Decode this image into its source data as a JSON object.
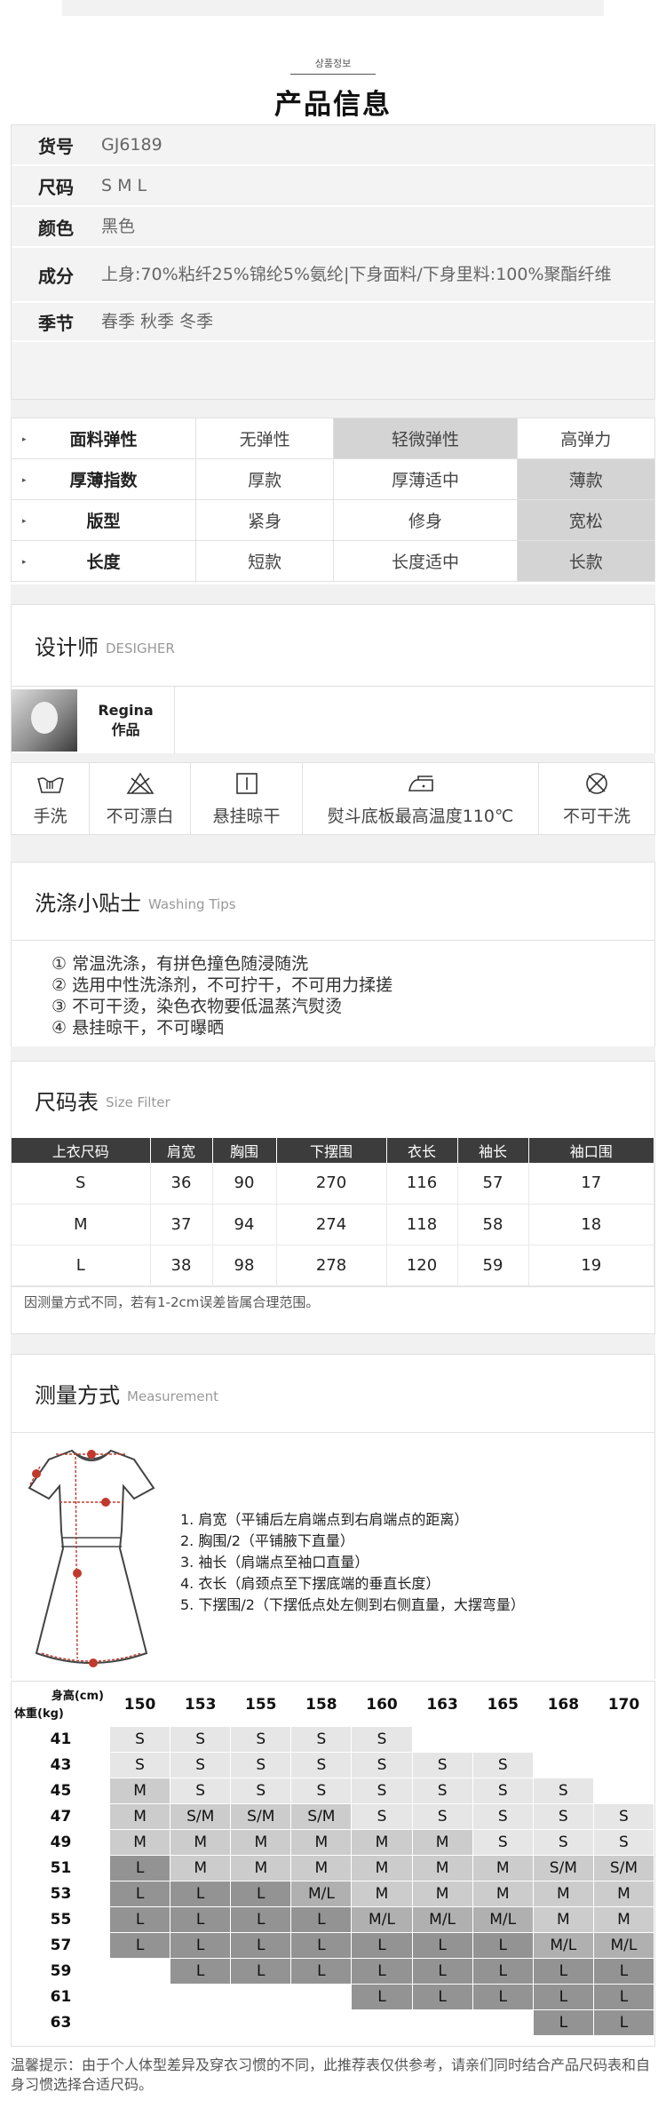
{
  "header": {
    "small_title": "상품정보",
    "big_title": "产品信息"
  },
  "info": [
    {
      "key": "货号",
      "value": "GJ6189"
    },
    {
      "key": "尺码",
      "value": "S M L"
    },
    {
      "key": "颜色",
      "value": "黑色"
    },
    {
      "key": "成分",
      "value": "上身:70%粘纤25%锦纶5%氨纶|下身面料/下身里料:100%聚酯纤维"
    },
    {
      "key": "季节",
      "value": "春季 秋季 冬季"
    }
  ],
  "attributes": [
    {
      "label": "面料弹性",
      "options": [
        "无弹性",
        "轻微弹性",
        "高弹力"
      ],
      "selected": 1
    },
    {
      "label": "厚薄指数",
      "options": [
        "厚款",
        "厚薄适中",
        "薄款"
      ],
      "selected": 2
    },
    {
      "label": "版型",
      "options": [
        "紧身",
        "修身",
        "宽松"
      ],
      "selected": 2
    },
    {
      "label": "长度",
      "options": [
        "短款",
        "长度适中",
        "长款"
      ],
      "selected": 2
    }
  ],
  "designer": {
    "title": "设计师",
    "title_en": "DESIGHER",
    "name": "Regina",
    "works": "作品"
  },
  "care": [
    {
      "icon": "hand-wash-icon",
      "label": "手洗"
    },
    {
      "icon": "no-bleach-icon",
      "label": "不可漂白"
    },
    {
      "icon": "hang-dry-icon",
      "label": "悬挂晾干"
    },
    {
      "icon": "iron-icon",
      "label": "熨斗底板最高温度110℃"
    },
    {
      "icon": "no-dry-clean-icon",
      "label": "不可干洗"
    }
  ],
  "washing_tips": {
    "title": "洗涤小贴士",
    "title_en": "Washing Tips",
    "items": [
      "① 常温洗涤，有拼色撞色随浸随洗",
      "② 选用中性洗涤剂，不可拧干，不可用力揉搓",
      "③ 不可干烫，染色衣物要低温蒸汽熨烫",
      "④ 悬挂晾干，不可曝晒"
    ]
  },
  "size_chart": {
    "title": "尺码表",
    "title_en": "Size Filter",
    "headers": [
      "上衣尺码",
      "肩宽",
      "胸围",
      "下摆围",
      "衣长",
      "袖长",
      "袖口围"
    ],
    "rows": [
      [
        "S",
        "36",
        "90",
        "270",
        "116",
        "57",
        "17"
      ],
      [
        "M",
        "37",
        "94",
        "274",
        "118",
        "58",
        "18"
      ],
      [
        "L",
        "38",
        "98",
        "278",
        "120",
        "59",
        "19"
      ]
    ],
    "note": "因测量方式不同，若有1-2cm误差皆属合理范围。"
  },
  "measurement": {
    "title": "测量方式",
    "title_en": "Measurement",
    "items": [
      "1. 肩宽（平铺后左肩端点到右肩端点的距离）",
      "2. 胸围/2（平铺腋下直量）",
      "3. 袖长（肩端点至袖口直量）",
      "4. 衣长（肩颈点至下摆底端的垂直长度）",
      "5. 下摆围/2（下摆低点处左侧到右侧直量，大摆弯量）"
    ]
  },
  "recommend": {
    "height_label": "身高(cm)",
    "weight_label": "体重(kg)",
    "heights": [
      "150",
      "153",
      "155",
      "158",
      "160",
      "163",
      "165",
      "168",
      "170"
    ],
    "rows": [
      {
        "w": "41",
        "c": [
          "S",
          "S",
          "S",
          "S",
          "S",
          "",
          "",
          "",
          ""
        ]
      },
      {
        "w": "43",
        "c": [
          "S",
          "S",
          "S",
          "S",
          "S",
          "S",
          "S",
          "",
          ""
        ]
      },
      {
        "w": "45",
        "c": [
          "M",
          "S",
          "S",
          "S",
          "S",
          "S",
          "S",
          "S",
          ""
        ]
      },
      {
        "w": "47",
        "c": [
          "M",
          "S/M",
          "S/M",
          "S/M",
          "S",
          "S",
          "S",
          "S",
          "S"
        ]
      },
      {
        "w": "49",
        "c": [
          "M",
          "M",
          "M",
          "M",
          "M",
          "M",
          "S",
          "S",
          "S"
        ]
      },
      {
        "w": "51",
        "c": [
          "L",
          "M",
          "M",
          "M",
          "M",
          "M",
          "M",
          "S/M",
          "S/M"
        ]
      },
      {
        "w": "53",
        "c": [
          "L",
          "L",
          "L",
          "M/L",
          "M",
          "M",
          "M",
          "M",
          "M"
        ]
      },
      {
        "w": "55",
        "c": [
          "L",
          "L",
          "L",
          "L",
          "M/L",
          "M/L",
          "M/L",
          "M",
          "M"
        ]
      },
      {
        "w": "57",
        "c": [
          "L",
          "L",
          "L",
          "L",
          "L",
          "L",
          "L",
          "M/L",
          "M/L"
        ]
      },
      {
        "w": "59",
        "c": [
          "",
          "L",
          "L",
          "L",
          "L",
          "L",
          "L",
          "L",
          "L"
        ]
      },
      {
        "w": "61",
        "c": [
          "",
          "",
          "",
          "",
          "L",
          "L",
          "L",
          "L",
          "L"
        ]
      },
      {
        "w": "63",
        "c": [
          "",
          "",
          "",
          "",
          "",
          "",
          "",
          "L",
          "L"
        ]
      }
    ],
    "warm_tip": "温馨提示：由于个人体型差异及穿衣习惯的不同，此推荐表仅供参考，请亲们同时结合产品尺码表和自身习惯选择合适尺码。"
  }
}
